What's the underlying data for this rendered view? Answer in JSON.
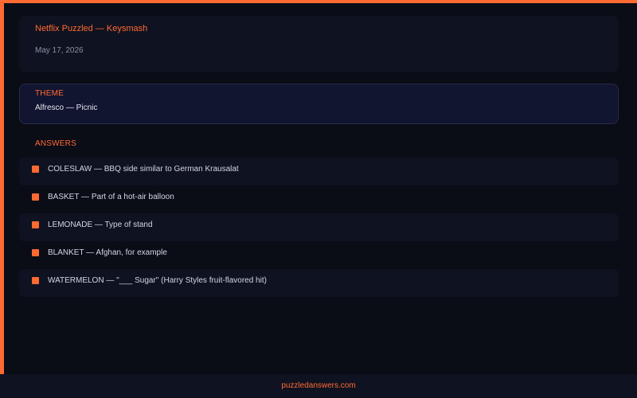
{
  "colors": {
    "accent": "#ff6a33",
    "background": "#0a0c16",
    "card": "#0f1220",
    "theme_card": "#121530",
    "text": "#d4d7e2",
    "muted": "#8a8fa3"
  },
  "header": {
    "title": "Netflix Puzzled — Keysmash",
    "date": "May 17, 2026"
  },
  "theme": {
    "label": "THEME",
    "value": "Alfresco — Picnic"
  },
  "answers": {
    "heading": "ANSWERS",
    "items": [
      {
        "text": "COLESLAW — BBQ side similar to German Krausalat"
      },
      {
        "text": "BASKET — Part of a hot-air balloon"
      },
      {
        "text": "LEMONADE — Type of stand"
      },
      {
        "text": "BLANKET — Afghan, for example"
      },
      {
        "text": "WATERMELON — \"___ Sugar\" (Harry Styles fruit-flavored hit)"
      }
    ]
  },
  "footer": {
    "link": "puzzledanswers.com"
  }
}
